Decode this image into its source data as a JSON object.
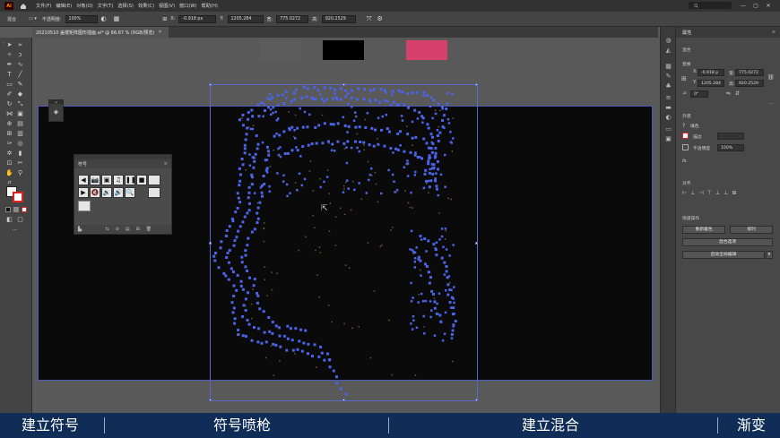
{
  "menubar": {
    "logo": "Ai",
    "menus": [
      "文件(F)",
      "编辑(E)",
      "对象(O)",
      "文字(T)",
      "选择(S)",
      "效果(C)",
      "视图(V)",
      "窗口(W)",
      "帮助(H)"
    ],
    "window_buttons": [
      "—",
      "▢",
      "✕"
    ]
  },
  "control_bar": {
    "selection_label": "混合",
    "opacity_label": "不透明度:",
    "opacity_value": "100%",
    "x_label": "X:",
    "x_value": "-0.918 px",
    "y_label": "Y:",
    "y_value": "1205.284",
    "w_label": "宽:",
    "w_value": "775.0272",
    "h_label": "高:",
    "h_value": "920.2529"
  },
  "document_tab": {
    "title": "20210510 盖楼矩阵图形插画.ai* @ 66.67 % (RGB/预览)",
    "close": "✕"
  },
  "swatches": [
    {
      "name": "gray",
      "color": "#5c5c5c"
    },
    {
      "name": "black",
      "color": "#000000"
    },
    {
      "name": "pink",
      "color": "#d6406a"
    }
  ],
  "artwork": {
    "dot_color": "#4b64e8",
    "faint_color": "#6a5a40"
  },
  "symbols_panel": {
    "title": "符号",
    "row1": [
      "◀",
      "📷",
      "▣",
      "♫",
      "❚❚",
      "■",
      ""
    ],
    "row2": [
      "▶",
      "🔇",
      "🔉",
      "🔊",
      "🔍",
      ""
    ],
    "footer": [
      "▙.",
      "⇆",
      "⊘",
      "▤",
      "⊞",
      "🗑"
    ]
  },
  "properties_panel": {
    "tab": "属性",
    "section_blend": "混合",
    "section_transform": "变换",
    "x_label": "X:",
    "x_value": "-0.918 p",
    "w_label": "宽:",
    "w_value": "775.0272",
    "y_label": "Y:",
    "y_value": "1205.284",
    "h_label": "高:",
    "h_value": "920.2529",
    "angle_label": "⊿:",
    "angle_value": "0°",
    "section_appearance": "外观",
    "fill_label": "填色",
    "stroke_label": "描边",
    "opacity_label": "不透明度",
    "opacity_value": "100%",
    "fx": "fx.",
    "section_align": "对齐",
    "section_quick": "快速操作",
    "btn_recolor": "重新着色",
    "btn_arrange": "排列",
    "btn_blend_options": "混合选项",
    "btn_global_edit": "启动全局编辑"
  },
  "subtitles": [
    "建立符号",
    "符号喷枪",
    "建立混合",
    "渐变"
  ]
}
